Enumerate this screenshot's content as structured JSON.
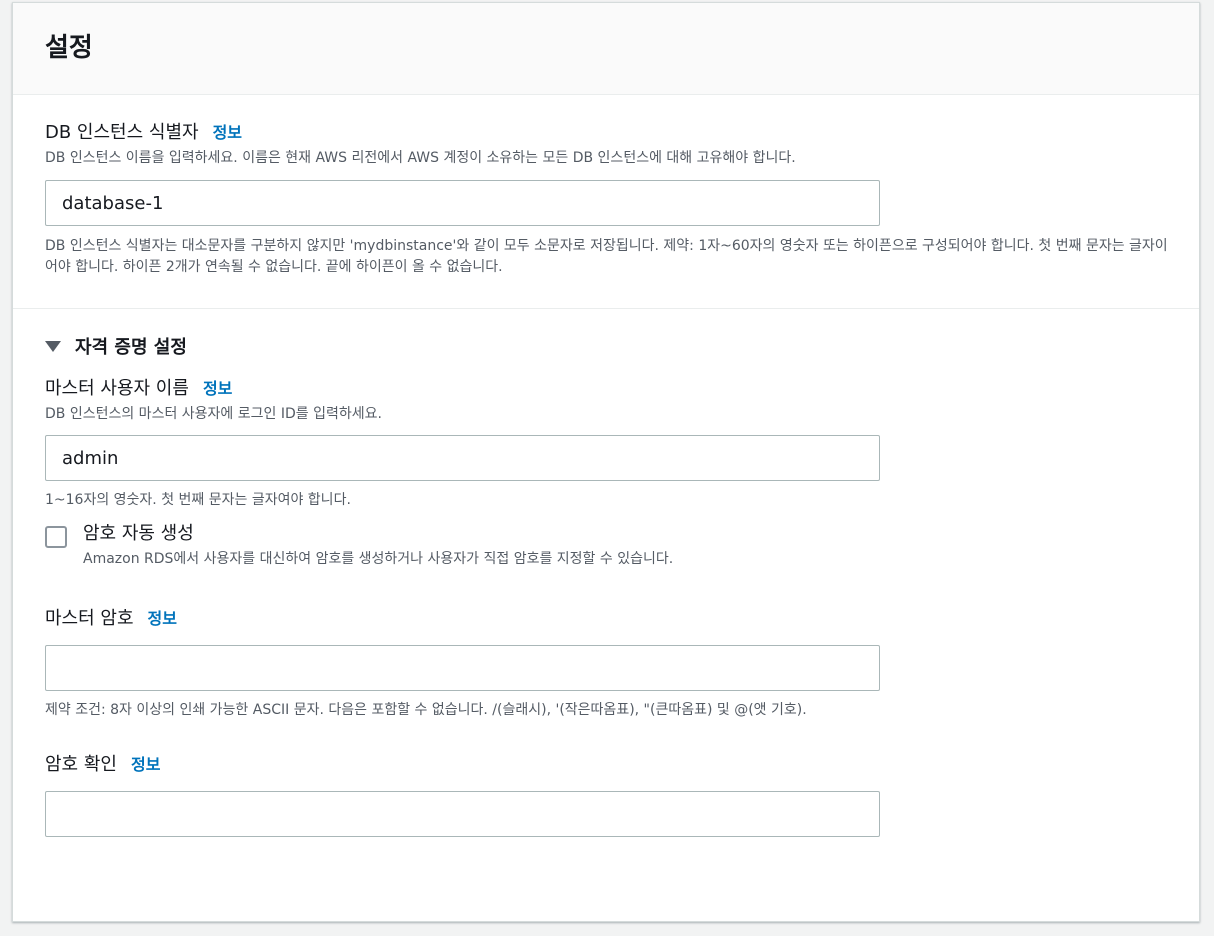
{
  "panel": {
    "title": "설정"
  },
  "identifier": {
    "label": "DB 인스턴스 식별자",
    "info": "정보",
    "description": "DB 인스턴스 이름을 입력하세요. 이름은 현재 AWS 리전에서 AWS 계정이 소유하는 모든 DB 인스턴스에 대해 고유해야 합니다.",
    "value": "database-1",
    "constraint": "DB 인스턴스 식별자는 대소문자를 구분하지 않지만 'mydbinstance'와 같이 모두 소문자로 저장됩니다. 제약: 1자~60자의 영숫자 또는 하이픈으로 구성되어야 합니다. 첫 번째 문자는 글자이어야 합니다. 하이픈 2개가 연속될 수 없습니다. 끝에 하이픈이 올 수 없습니다."
  },
  "credentials": {
    "section_label": "자격 증명 설정",
    "username": {
      "label": "마스터 사용자 이름",
      "info": "정보",
      "description": "DB 인스턴스의 마스터 사용자에 로그인 ID를 입력하세요.",
      "value": "admin",
      "constraint": "1~16자의 영숫자. 첫 번째 문자는 글자여야 합니다."
    },
    "auto_password": {
      "label": "암호 자동 생성",
      "description": "Amazon RDS에서 사용자를 대신하여 암호를 생성하거나 사용자가 직접 암호를 지정할 수 있습니다.",
      "checked": false
    },
    "password": {
      "label": "마스터 암호",
      "info": "정보",
      "value": "",
      "constraint": "제약 조건: 8자 이상의 인쇄 가능한 ASCII 문자. 다음은 포함할 수 없습니다. /(슬래시), '(작은따옴표), \"(큰따옴표) 및 @(앳 기호)."
    },
    "confirm": {
      "label": "암호 확인",
      "info": "정보",
      "value": ""
    }
  },
  "colors": {
    "link": "#0073bb",
    "text": "#16191f",
    "secondary_text": "#545b64",
    "border": "#aab7b8"
  }
}
